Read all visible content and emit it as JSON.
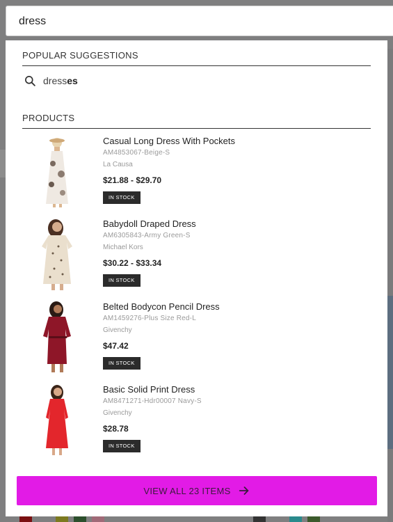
{
  "search": {
    "value": "dress"
  },
  "popular": {
    "heading": "POPULAR SUGGESTIONS",
    "suggestion": {
      "base": "dress",
      "suffix": "es",
      "icon": "search-icon"
    }
  },
  "products_section": {
    "heading": "PRODUCTS",
    "items": [
      {
        "name": "Casual Long Dress With Pockets",
        "sku": "AM4853067-Beige-S",
        "brand": "La Causa",
        "price": "$21.88 - $29.70",
        "stock": "IN STOCK",
        "image_color": "#efe7df"
      },
      {
        "name": "Babydoll Draped Dress",
        "sku": "AM6305843-Army Green-S",
        "brand": "Michael Kors",
        "price": "$30.22 - $33.34",
        "stock": "IN STOCK",
        "image_color": "#e9dcc8"
      },
      {
        "name": "Belted Bodycon Pencil Dress",
        "sku": "AM1459276-Plus Size Red-L",
        "brand": "Givenchy",
        "price": "$47.42",
        "stock": "IN STOCK",
        "image_color": "#8e1628"
      },
      {
        "name": "Basic Solid Print Dress",
        "sku": "AM8471271-Hdr00007 Navy-S",
        "brand": "Givenchy",
        "price": "$28.78",
        "stock": "IN STOCK",
        "image_color": "#e3262c"
      }
    ]
  },
  "view_all": {
    "label": "VIEW ALL 23 ITEMS",
    "icon": "arrow-right-icon"
  },
  "colors": {
    "accent": "#e21be6",
    "stock_badge": "#2b2b2b",
    "overlay": "#7f7f80"
  }
}
